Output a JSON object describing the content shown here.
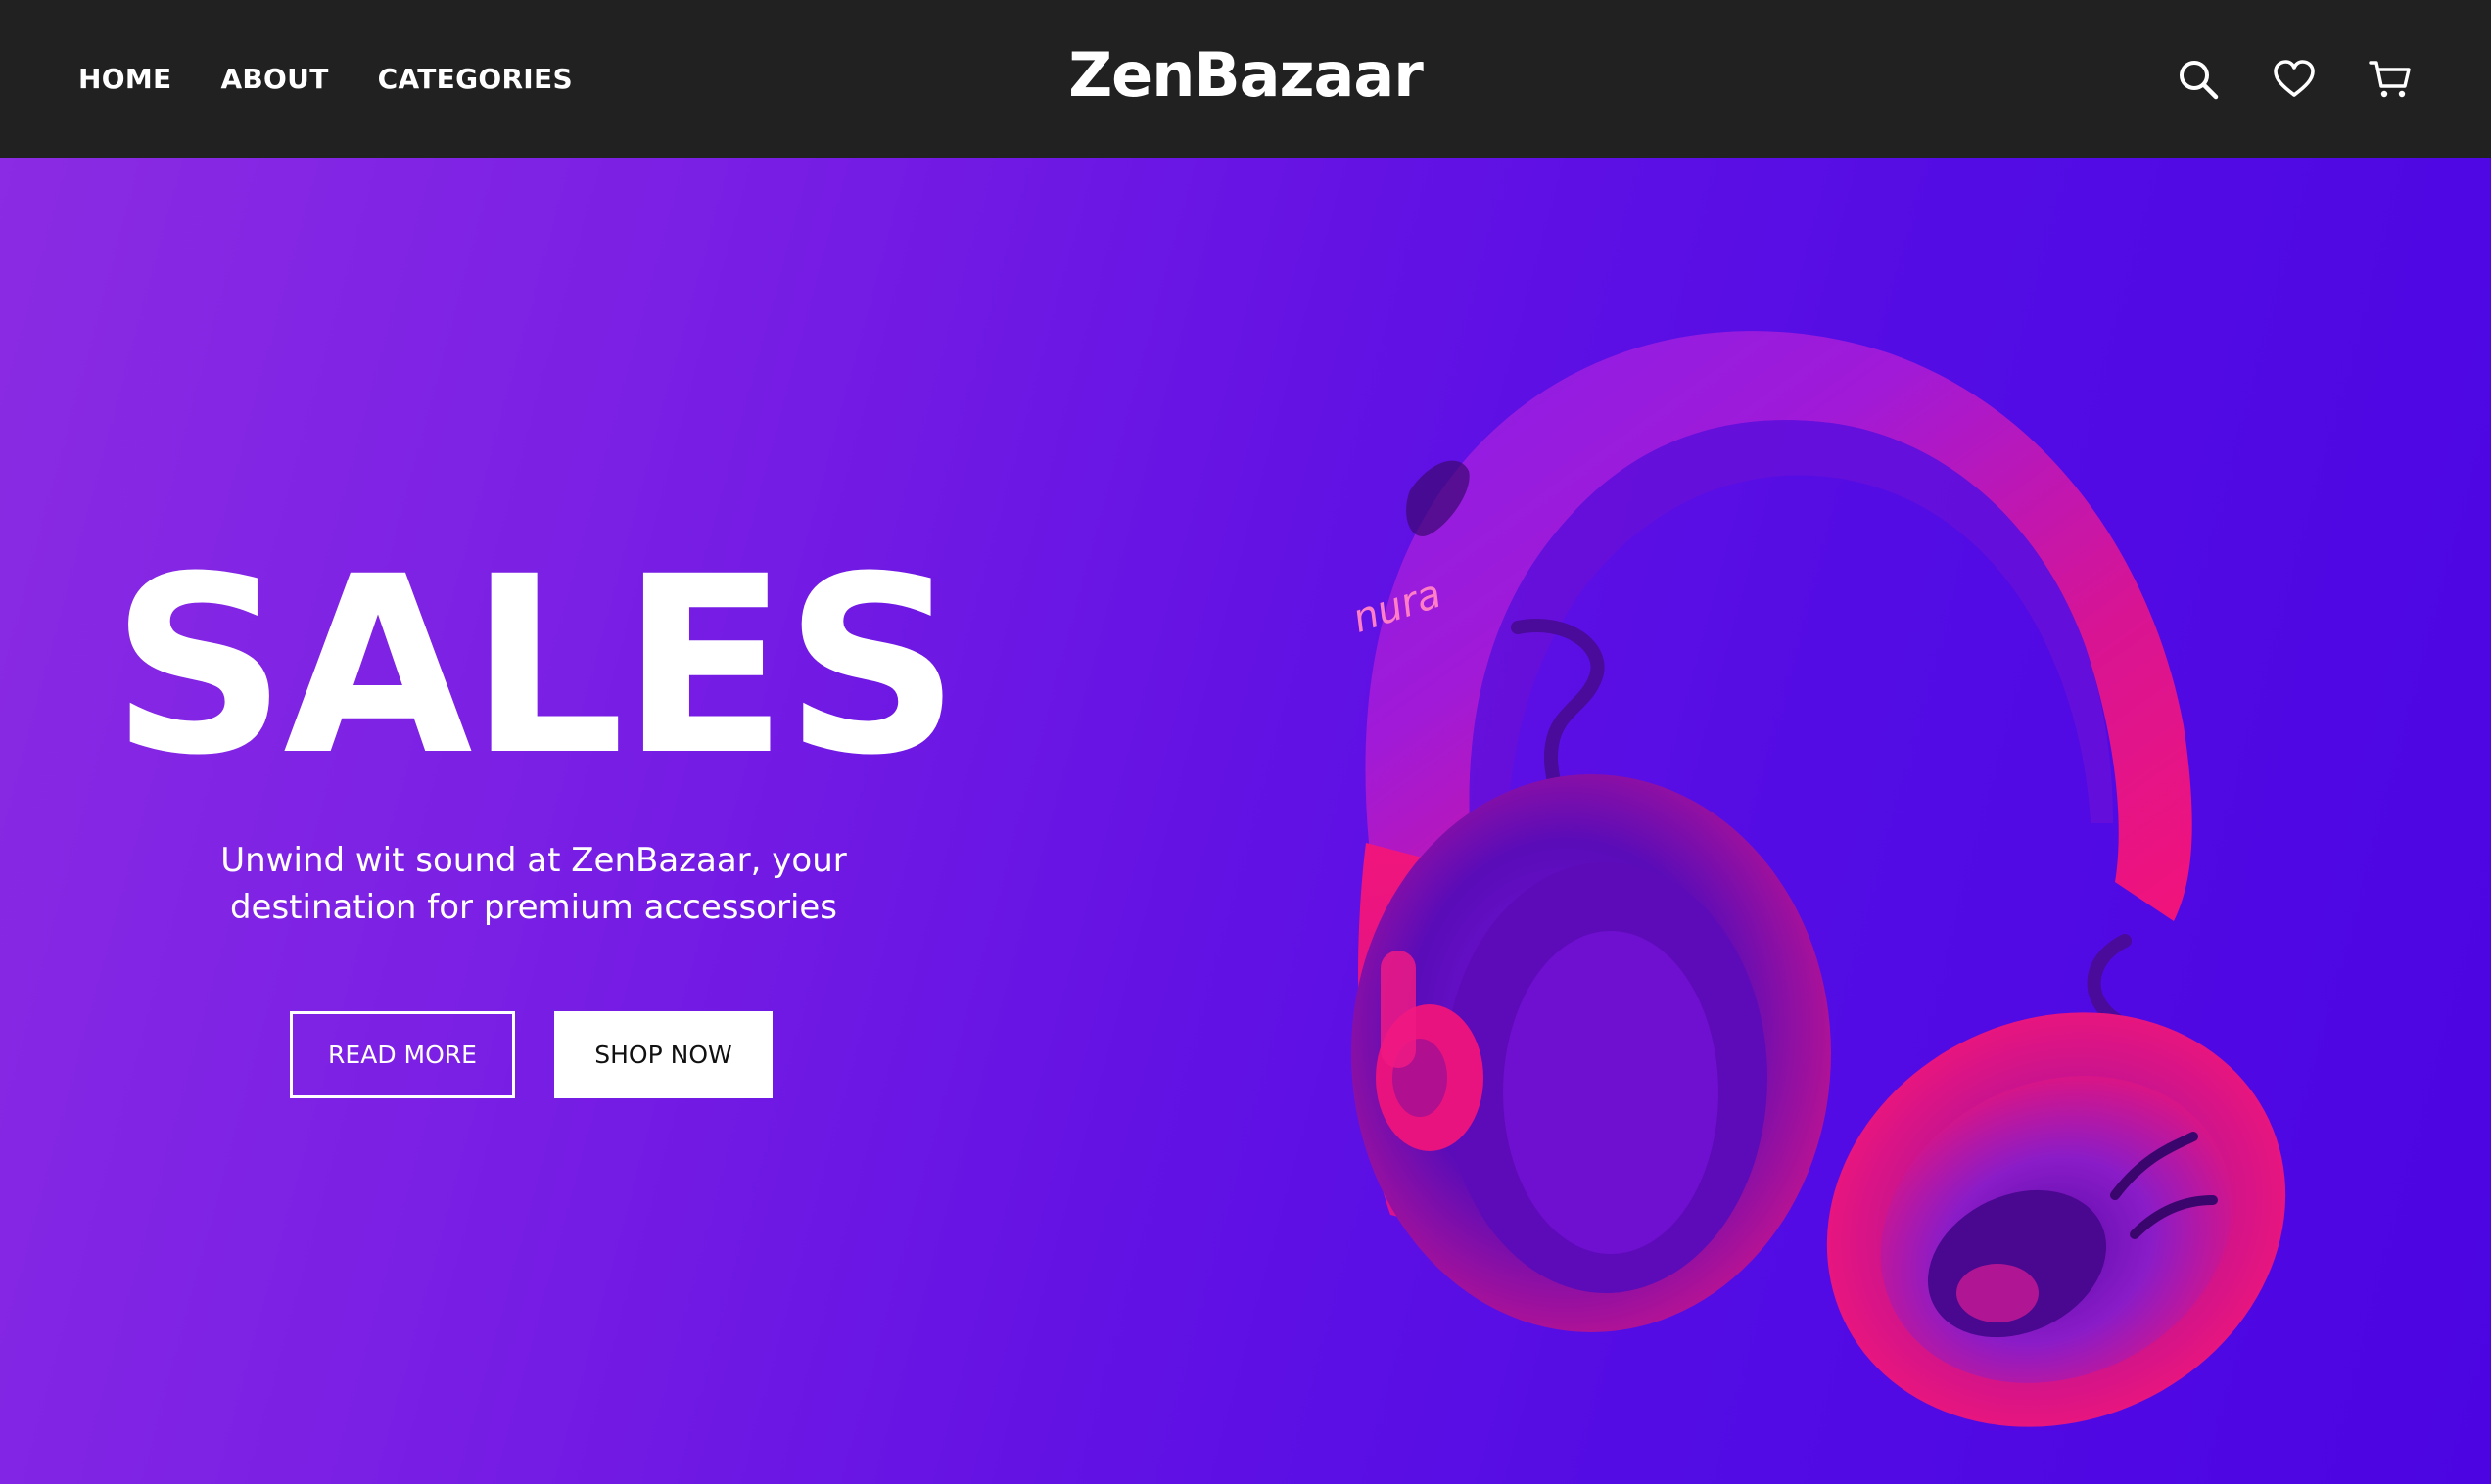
{
  "header": {
    "brand": "ZenBazaar",
    "nav": [
      {
        "label": "HOME"
      },
      {
        "label": "ABOUT"
      },
      {
        "label": "CATEGORIES"
      }
    ],
    "icons": [
      "search-icon",
      "heart-icon",
      "cart-icon"
    ]
  },
  "hero": {
    "title": "SALES",
    "subtitle_line1": "Unwind wit sound at ZenBazaar, your",
    "subtitle_line2": "destination for premium accessories",
    "read_more_label": "READ MORE",
    "shop_now_label": "SHOP NOW",
    "headphone_brand": "nura"
  },
  "colors": {
    "navbar": "#212121",
    "hero_gradient_start": "#8b2be3",
    "hero_gradient_end": "#4c05e2",
    "headphone_pink": "#f0137a",
    "text": "#ffffff"
  }
}
